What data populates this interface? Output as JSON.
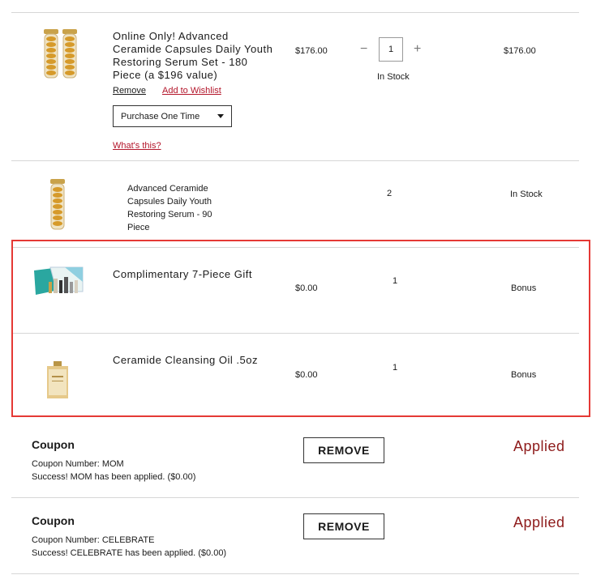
{
  "items": [
    {
      "name": "Online Only! Advanced Ceramide Capsules Daily Youth Restoring Serum Set - 180 Piece (a $196 value)",
      "price": "$176.00",
      "quantity": "1",
      "stock": "In Stock",
      "total": "$176.00",
      "remove_label": "Remove",
      "wishlist_label": "Add to Wishlist",
      "purchase_option": "Purchase One Time",
      "whats_this": "What's this?",
      "minus": "−",
      "plus": "+"
    },
    {
      "name": "Advanced Ceramide Capsules Daily Youth Restoring Serum - 90 Piece",
      "quantity": "2",
      "stock": "In Stock"
    },
    {
      "name": "Complimentary 7-Piece Gift",
      "price": "$0.00",
      "quantity": "1",
      "status": "Bonus"
    },
    {
      "name": "Ceramide Cleansing Oil .5oz",
      "price": "$0.00",
      "quantity": "1",
      "status": "Bonus"
    }
  ],
  "coupons": [
    {
      "title": "Coupon",
      "number": "Coupon Number: MOM",
      "message": "Success! MOM has been applied. ($0.00)",
      "button": "REMOVE",
      "status": "Applied"
    },
    {
      "title": "Coupon",
      "number": "Coupon Number: CELEBRATE",
      "message": "Success! CELEBRATE has been applied. ($0.00)",
      "button": "REMOVE",
      "status": "Applied"
    }
  ],
  "colors": {
    "accent_red": "#b3152a",
    "applied_red": "#8e1b1b",
    "highlight_border": "#e53935"
  }
}
